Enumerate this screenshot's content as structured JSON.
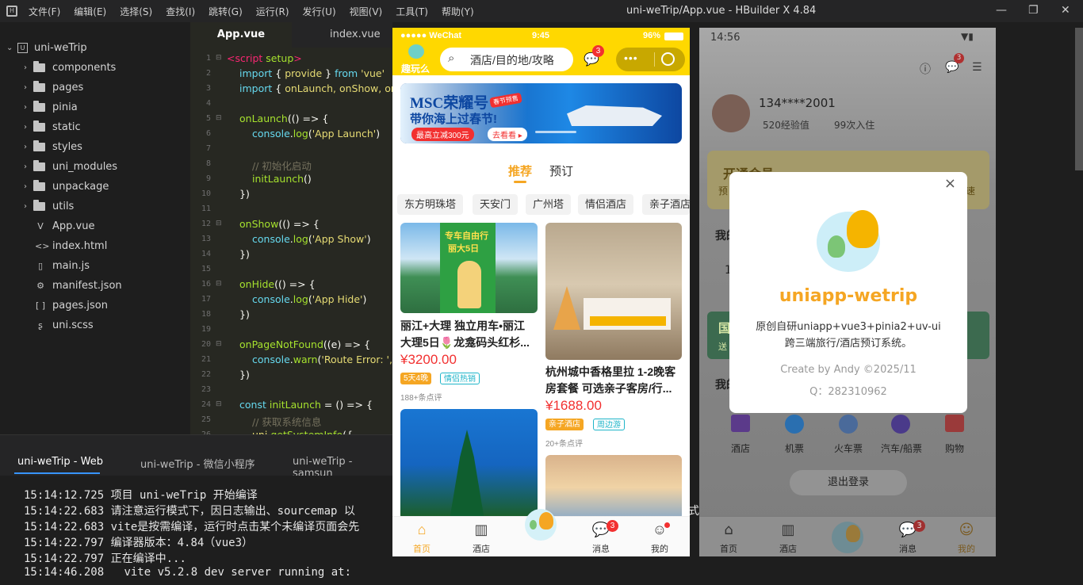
{
  "menubar": {
    "items": [
      "文件(F)",
      "编辑(E)",
      "选择(S)",
      "查找(I)",
      "跳转(G)",
      "运行(R)",
      "发行(U)",
      "视图(V)",
      "工具(T)",
      "帮助(Y)"
    ],
    "title": "uni-weTrip/App.vue - HBuilder X 4.84"
  },
  "sidebar": {
    "project": "uni-weTrip",
    "folders": [
      "components",
      "pages",
      "pinia",
      "static",
      "styles",
      "uni_modules",
      "unpackage",
      "utils"
    ],
    "files": [
      {
        "name": "App.vue",
        "icon": "V"
      },
      {
        "name": "index.html",
        "icon": "<>"
      },
      {
        "name": "main.js",
        "icon": "▯"
      },
      {
        "name": "manifest.json",
        "icon": "⚙"
      },
      {
        "name": "pages.json",
        "icon": "[ ]"
      },
      {
        "name": "uni.scss",
        "icon": "ʂ"
      }
    ]
  },
  "editor": {
    "tabs": [
      "App.vue",
      "index.vue"
    ],
    "line_numbers": [
      "1",
      "2",
      "3",
      "4",
      "5",
      "6",
      "7",
      "8",
      "9",
      "10",
      "11",
      "12",
      "13",
      "14",
      "15",
      "16",
      "17",
      "18",
      "19",
      "20",
      "21",
      "22",
      "23",
      "24",
      "25",
      "26"
    ]
  },
  "console": {
    "tabs": [
      "uni-weTrip - Web",
      "uni-weTrip - 微信小程序",
      "uni-weTrip - samsun"
    ],
    "logs": [
      {
        "time": "15:14:12.725",
        "text": "项目 uni-weTrip 开始编译"
      },
      {
        "time": "15:14:22.683",
        "text": "请注意运行模式下，因日志输出、sourcemap 以"
      },
      {
        "time": "15:14:22.683",
        "text": "vite是按需编译，运行时点击某个未编译页面会先"
      },
      {
        "time": "15:14:22.797",
        "text": "编译器版本：4.84（vue3）"
      },
      {
        "time": "15:14:22.797",
        "text": "正在编译中..."
      },
      {
        "time": "15:14:46.208",
        "text": "  vite v5.2.8 dev server running at:"
      }
    ],
    "overflow_char": "式。"
  },
  "phone": {
    "status": {
      "carrier": "●●●●● WeChat",
      "time": "9:45",
      "battery": "96%"
    },
    "logo_text": "趣玩么",
    "search_placeholder": "酒店/目的地/攻略",
    "msg_badge": "3",
    "banner": {
      "title": "MSC荣耀号",
      "sub": "带你海上过春节!",
      "promo": "最高立减300元",
      "cta": "去看看 ▸",
      "ribbon": "春节预售"
    },
    "seg_tabs": [
      "推荐",
      "预订"
    ],
    "chips": [
      "东方明珠塔",
      "天安门",
      "广州塔",
      "情侣酒店",
      "亲子酒店"
    ],
    "cards": [
      {
        "title": "丽江+大理 独立用车•丽江大理5日🌷龙龛码头红杉...",
        "price": "¥3200.00",
        "badges": [
          "5天4晚",
          "情侣热销"
        ],
        "reviews": "188+条点评",
        "img_title": "专车自由行",
        "img_sub": "丽大5日"
      },
      {
        "title": "杭州城中香格里拉 1-2晚客房套餐 可选亲子客房/行...",
        "price": "¥1688.00",
        "badges": [
          "亲子酒店",
          "周边游"
        ],
        "reviews": "20+条点评"
      }
    ],
    "tabbar": [
      "首页",
      "酒店",
      "",
      "消息",
      "我的"
    ],
    "tab_badge": "3"
  },
  "right": {
    "status_time": "14:56",
    "msg_badge": "3",
    "user": {
      "name": "134****2001",
      "exp": "520经验值",
      "stays": "99次入住"
    },
    "vip": "开通会员",
    "side_texts": [
      "我的",
      "我的",
      "预",
      "速",
      "1",
      "国",
      "送"
    ],
    "services": [
      "酒店",
      "机票",
      "火车票",
      "汽车/船票",
      "购物"
    ],
    "logout": "退出登录",
    "tabbar": [
      "首页",
      "酒店",
      "",
      "消息",
      "我的"
    ],
    "tab_badge": "3",
    "modal": {
      "title": "uniapp-wetrip",
      "desc1": "原创自研uniapp+vue3+pinia2+uv-ui",
      "desc2": "跨三端旅行/酒店预订系统。",
      "credit": "Create by Andy ©2025/11",
      "qq": "Q：282310962"
    }
  },
  "colors": {
    "accent": "#ffd800",
    "price": "#f23030",
    "orange": "#f5a623",
    "editor_bg": "#272822"
  }
}
